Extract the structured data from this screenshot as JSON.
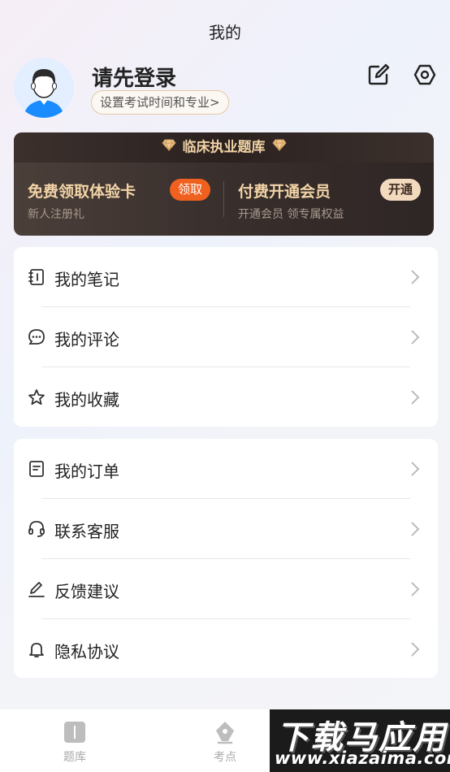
{
  "header": {
    "title": "我的"
  },
  "profile": {
    "login_text": "请先登录",
    "exam_setting_label": "设置考试时间和专业>"
  },
  "vip": {
    "header_title": "临床执业题库",
    "trial": {
      "title": "免费领取体验卡",
      "subtitle": "新人注册礼",
      "button": "领取"
    },
    "member": {
      "title": "付费开通会员",
      "subtitle": "开通会员 领专属权益",
      "button": "开通"
    },
    "colors": {
      "accent": "#f1d3a6",
      "claim": "#f0601f",
      "open": "#f3d9bd"
    }
  },
  "menu_group_1": [
    {
      "label": "我的笔记",
      "icon": "notebook-icon"
    },
    {
      "label": "我的评论",
      "icon": "comment-icon"
    },
    {
      "label": "我的收藏",
      "icon": "star-icon"
    }
  ],
  "menu_group_2": [
    {
      "label": "我的订单",
      "icon": "order-icon"
    },
    {
      "label": "联系客服",
      "icon": "headset-icon"
    },
    {
      "label": "反馈建议",
      "icon": "pen-icon"
    },
    {
      "label": "隐私协议",
      "icon": "bell-icon"
    }
  ],
  "tab_bar": {
    "items": [
      {
        "label": "题库",
        "icon": "book-icon"
      },
      {
        "label": "考点",
        "icon": "compass-pen-icon"
      }
    ]
  },
  "watermark": {
    "title": "下载马应用",
    "url": "www.xiazaima.com"
  }
}
